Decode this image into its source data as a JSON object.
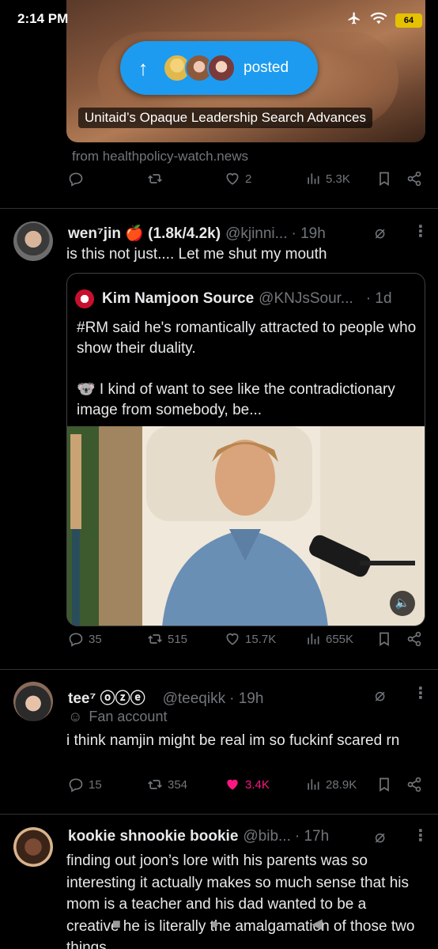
{
  "status": {
    "time": "2:14 PM",
    "battery": "64"
  },
  "top_article": {
    "title": "Unitaid’s Opaque Leadership Search Advances",
    "source": "from healthpolicy-watch.news",
    "stats": {
      "replies": "",
      "reposts": "",
      "likes": "2",
      "views": "5.3K"
    }
  },
  "posted_pill": {
    "label": "posted"
  },
  "tweet1": {
    "name": "wen⁷jin 🍎 (1.8k/4.2k)",
    "handle": "@kjinni...",
    "time": "· 19h",
    "text": "is this not just.... Let me shut my mouth",
    "quote": {
      "name": "Kim Namjoon Source",
      "handle": "@KNJsSour...",
      "time": "· 1d",
      "text_line1": "#RM said he's romantically attracted to people who show their duality.",
      "text_line2": "🐨 I kind of want to see like the contradictionary image from somebody, be..."
    },
    "stats": {
      "replies": "35",
      "reposts": "515",
      "likes": "15.7K",
      "views": "655K"
    }
  },
  "tweet2": {
    "name": "tee⁷ ⓞⓩⓔ",
    "handle": "@teeqikk",
    "time": "· 19h",
    "label": "Fan account",
    "text": "i think namjin might be real im so fuckinf scared rn",
    "stats": {
      "replies": "15",
      "reposts": "354",
      "likes": "3.4K",
      "views": "28.9K"
    }
  },
  "tweet3": {
    "name": "kookie shnookie bookie",
    "handle": "@bib...",
    "time": "· 17h",
    "text": "finding out joon’s lore with his parents was so interesting it actually makes so much sense that his mom is a teacher and his dad wanted to be a creative he is literally the amalgamation of those two things"
  },
  "colors": {
    "accent": "#1d9bf0",
    "like_active": "#f91880",
    "muted": "#71767b"
  }
}
